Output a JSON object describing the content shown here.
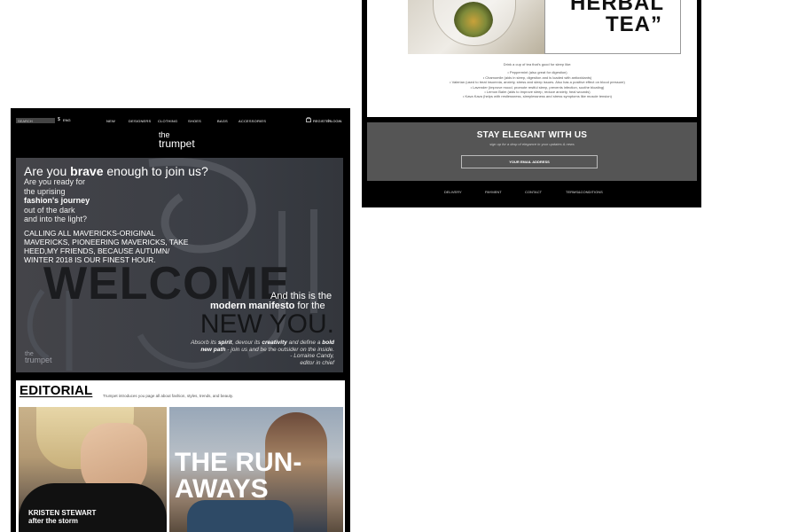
{
  "right_panel": {
    "tea_title_line1": "HERBAL",
    "tea_title_line2": "TEA”",
    "tea_intro": "Drink a cup of tea that's good for sleep like:",
    "tea_list": [
      "• Peppermint (also great for digestion)",
      "• Chamomile (aids in sleep, digestion and is loaded with antioxidants)",
      "• Valerian (used to treat insomnia, anxiety, stress and sleep issues. Also has a positive effect on blood pressure)",
      "• Lavender (improve mood, promote restful sleep, prevents infection, soothe bloating)",
      "• Lemon Balm (aids to improve sleep, reduce anxiety, heal wounds)",
      "• Kava Kava (helps with restlessness, sleeplessness and stress symptoms like muscle tension)"
    ],
    "newsletter": {
      "title": "STAY ELEGANT WITH US",
      "subtitle": "sign up for a drop of elegance in your updates & news",
      "input_placeholder": "YOUR EMAIL ADDRESS"
    },
    "footer_links": [
      "DELIVERY",
      "PAYMENT",
      "CONTACT",
      "TERMS&CONDITIONS"
    ]
  },
  "left_panel": {
    "search_placeholder": "SEARCH",
    "currency": "$",
    "language": "ENG",
    "nav": [
      "NEW",
      "DESIGNERS",
      "CLOTHING",
      "SHOES",
      "BAGS",
      "ACCESSORIES"
    ],
    "register": "REGISTER",
    "separator": "|",
    "login": "LOGIN",
    "logo_top": "the",
    "logo_bottom": "trumpet",
    "hero": {
      "q_pre": "Are you ",
      "q_bold": "brave",
      "q_post": " enough to join us?",
      "line1": "Are you ready for",
      "line2": "the uprising",
      "line3": "fashion's journey",
      "line4": "out of the dark",
      "line5": "and into the light?",
      "call": "CALLING ALL MAVERICKS-ORIGINAL MAVERICKS, PIONEERING MAVERICKS, TAKE HEED,MY FRIENDS, BECAUSE AUTUMN/ WINTER 2018 IS OUR FINEST HOUR.",
      "welcome": "WELCOME",
      "and_this": "And this is the",
      "manifesto_bold": "modern manifesto",
      "manifesto_post": " for the",
      "new_you": "NEW YOU.",
      "quote_1": "Absorb its ",
      "quote_spirit": "spirit",
      "quote_2": ", devour its ",
      "quote_creativity": "creativity",
      "quote_3": " and define a ",
      "quote_bold_new": "bold new path",
      "quote_4": " - join us and be the outsider on the inside.",
      "signature_name": "- Lorraine Candy,",
      "signature_role": "editor in chief",
      "watermark_top": "the",
      "watermark_bottom": "trumpet"
    },
    "editorial": {
      "title": "EDITORIAL",
      "description": "Trumpet introduces you page all about fashion, styles, trends, and beauty.",
      "card1_line1": "KRISTEN STEWART",
      "card1_line2": "after the storm",
      "card2_line1": "THE RUN-",
      "card2_line2": "AWAYS"
    }
  }
}
